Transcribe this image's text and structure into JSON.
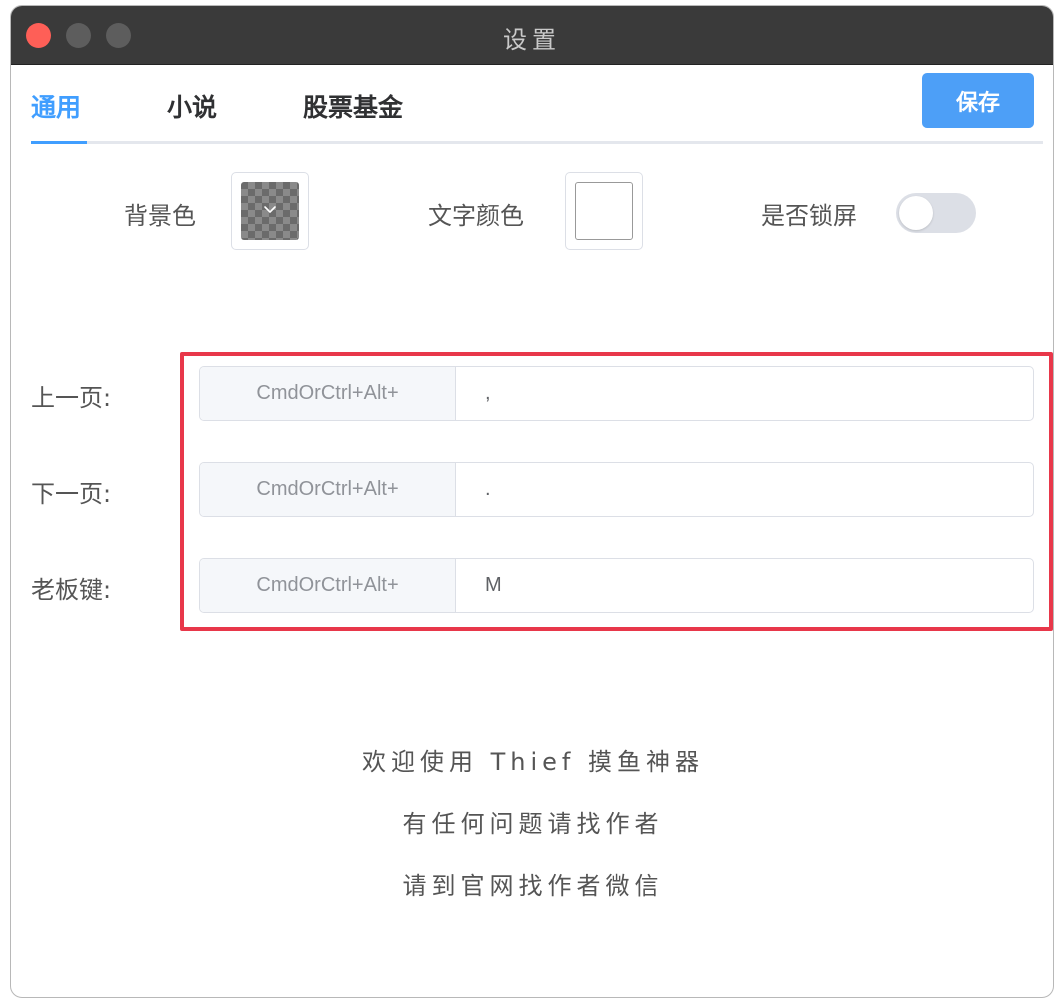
{
  "window": {
    "title": "设置"
  },
  "tabs": [
    {
      "label": "通用",
      "active": true
    },
    {
      "label": "小说",
      "active": false
    },
    {
      "label": "股票基金",
      "active": false
    }
  ],
  "toolbar": {
    "save_label": "保存"
  },
  "appearance": {
    "background_color_label": "背景色",
    "text_color_label": "文字颜色",
    "lock_screen_label": "是否锁屏",
    "lock_screen_enabled": false
  },
  "shortcuts": [
    {
      "label": "上一页:",
      "prefix": "CmdOrCtrl+Alt+",
      "value": ","
    },
    {
      "label": "下一页:",
      "prefix": "CmdOrCtrl+Alt+",
      "value": "."
    },
    {
      "label": "老板键:",
      "prefix": "CmdOrCtrl+Alt+",
      "value": "M"
    }
  ],
  "footer": {
    "line1": "欢迎使用 Thief 摸鱼神器",
    "line2": "有任何问题请找作者",
    "line3": "请到官网找作者微信"
  },
  "colors": {
    "accent": "#409eff",
    "highlight_border": "#e8374a",
    "titlebar": "#3a3a3a",
    "close_button": "#fe5f57"
  }
}
